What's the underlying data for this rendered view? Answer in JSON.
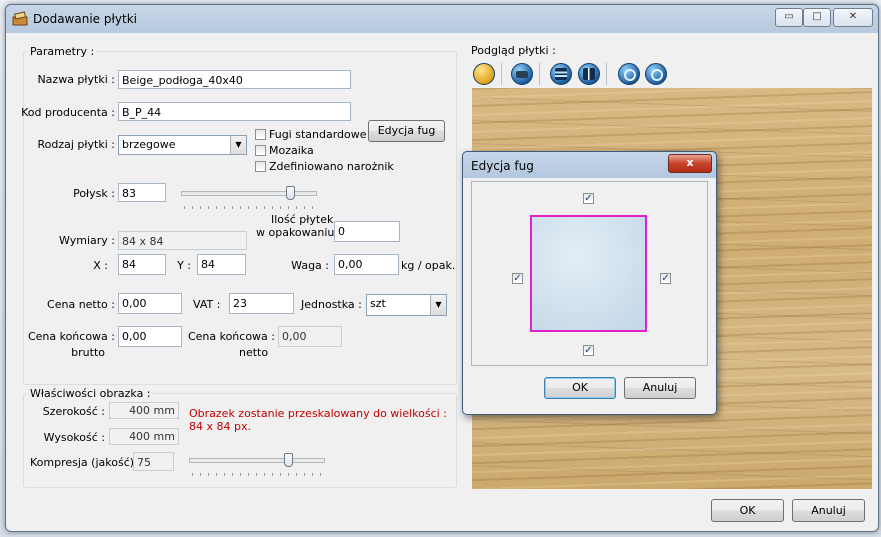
{
  "window": {
    "title": "Dodawanie płytki"
  },
  "params": {
    "group_label": "Parametry :",
    "name_label": "Nazwa płytki :",
    "name_value": "Beige_podłoga_40x40",
    "code_label": "Kod producenta :",
    "code_value": "B_P_44",
    "type_label": "Rodzaj płytki :",
    "type_value": "brzegowe",
    "fugi_std_label": "Fugi standardowe",
    "mozaika_label": "Mozaika",
    "corner_label": "Zdefiniowano narożnik",
    "edit_fug_button": "Edycja fug",
    "gloss_label": "Połysk :",
    "gloss_value": "83",
    "gloss_slider_fraction": 0.83,
    "dims_label": "Wymiary :",
    "dims_value": "84 x 84",
    "count_label_line1": "Ilość płytek",
    "count_label_line2": "w opakowaniu",
    "count_value": "0",
    "x_label": "X :",
    "x_value": "84",
    "y_label": "Y :",
    "y_value": "84",
    "weight_label": "Waga :",
    "weight_value": "0,00",
    "weight_unit": "kg / opak.",
    "net_price_label": "Cena netto :",
    "net_price_value": "0,00",
    "vat_label": "VAT :",
    "vat_value": "23",
    "unit_label": "Jednostka :",
    "unit_value": "szt",
    "final_gross_label_line1": "Cena końcowa :",
    "final_gross_label_line2": "brutto",
    "final_gross_value": "0,00",
    "final_net_label_line1": "Cena końcowa :",
    "final_net_label_line2": "netto",
    "final_net_value": "0,00"
  },
  "image_props": {
    "group_label": "Właściwości obrazka :",
    "width_label": "Szerokość :",
    "width_value": "400 mm",
    "height_label": "Wysokość :",
    "height_value": "400 mm",
    "compression_label": "Kompresja (jakość) :",
    "compression_value": "75",
    "compression_slider_fraction": 0.75,
    "notice_line1": "Obrazek zostanie przeskalowany do wielkości :",
    "notice_line2": "84 x 84 px.",
    "notice_color": "#c00000"
  },
  "preview": {
    "label": "Podgląd płytki :",
    "tools": [
      "open-folder-icon",
      "scanner-icon",
      "flip-horizontal-icon",
      "flip-vertical-icon",
      "rotate-left-icon",
      "rotate-right-icon"
    ]
  },
  "dialog": {
    "title": "Edycja fug",
    "close_glyph": "x",
    "top_checked": "✓",
    "left_checked": "✓",
    "right_checked": "✓",
    "bottom_checked": "✓",
    "ok": "OK",
    "cancel": "Anuluj"
  },
  "footer": {
    "ok": "OK",
    "cancel": "Anuluj"
  },
  "titlebar": {
    "minimize": "▭",
    "maximize": "□",
    "close": "✕"
  }
}
